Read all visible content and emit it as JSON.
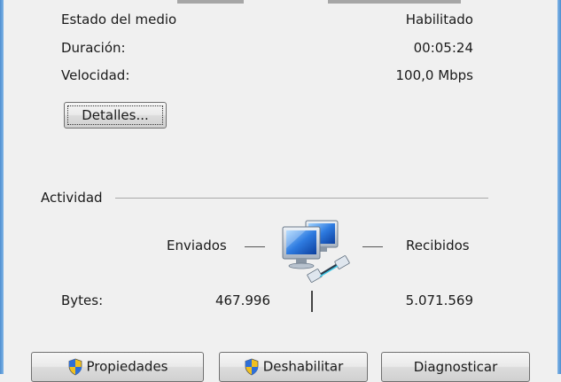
{
  "connection_info": {
    "rows": [
      {
        "label": "Estado del medio",
        "value": "Habilitado"
      },
      {
        "label": "Duración:",
        "value": "00:05:24"
      },
      {
        "label": "Velocidad:",
        "value": "100,0 Mbps"
      }
    ],
    "details_button": "Detalles..."
  },
  "activity": {
    "title": "Actividad",
    "sent_label": "Enviados",
    "received_label": "Recibidos",
    "bytes_label": "Bytes:",
    "bytes_sent": "467.996",
    "bytes_received": "5.071.569",
    "icon": "network-computers-icon"
  },
  "buttons": {
    "properties": "Propiedades",
    "disable": "Deshabilitar",
    "diagnose": "Diagnosticar"
  },
  "colors": {
    "window_frame": "#4f8fd0",
    "background": "#f0f0f0",
    "shield_blue": "#2f6fd6",
    "shield_yellow": "#f0c020"
  }
}
